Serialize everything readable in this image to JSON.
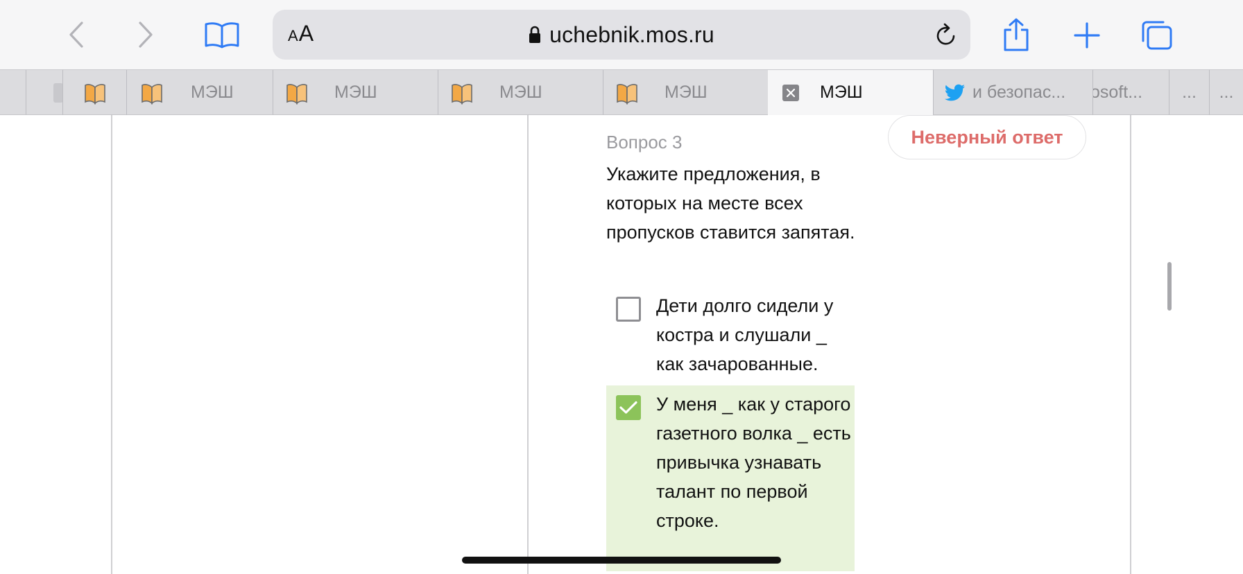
{
  "browser": {
    "address_bar": {
      "text_size_small": "A",
      "text_size_big": "A",
      "url": "uchebnik.mos.ru"
    },
    "tabs": [
      {
        "label": ""
      },
      {
        "label": ""
      },
      {
        "label": "МЭШ"
      },
      {
        "label": "МЭШ"
      },
      {
        "label": "МЭШ"
      },
      {
        "label": "МЭШ"
      },
      {
        "label": "МЭШ"
      },
      {
        "label": "и безопас..."
      },
      {
        "label": "osoft..."
      },
      {
        "label": "..."
      },
      {
        "label": "..."
      }
    ]
  },
  "question": {
    "number_label": "Вопрос 3",
    "verdict": "Неверный ответ",
    "text": "Укажите предложения, в которых на месте всех пропусков ставится запятая.",
    "options": [
      {
        "text": "Дети долго сидели у костра и слушали _ как зачарованные.",
        "checked": false
      },
      {
        "text": "У меня _ как у старого газетного волка _ есть привычка узнавать талант по первой строке.",
        "checked": true
      }
    ]
  },
  "colors": {
    "accent_blue": "#2f7bf5",
    "verdict_red": "#dd6c6a",
    "selected_bg": "#e8f3da",
    "checkbox_green": "#8cc35a"
  }
}
